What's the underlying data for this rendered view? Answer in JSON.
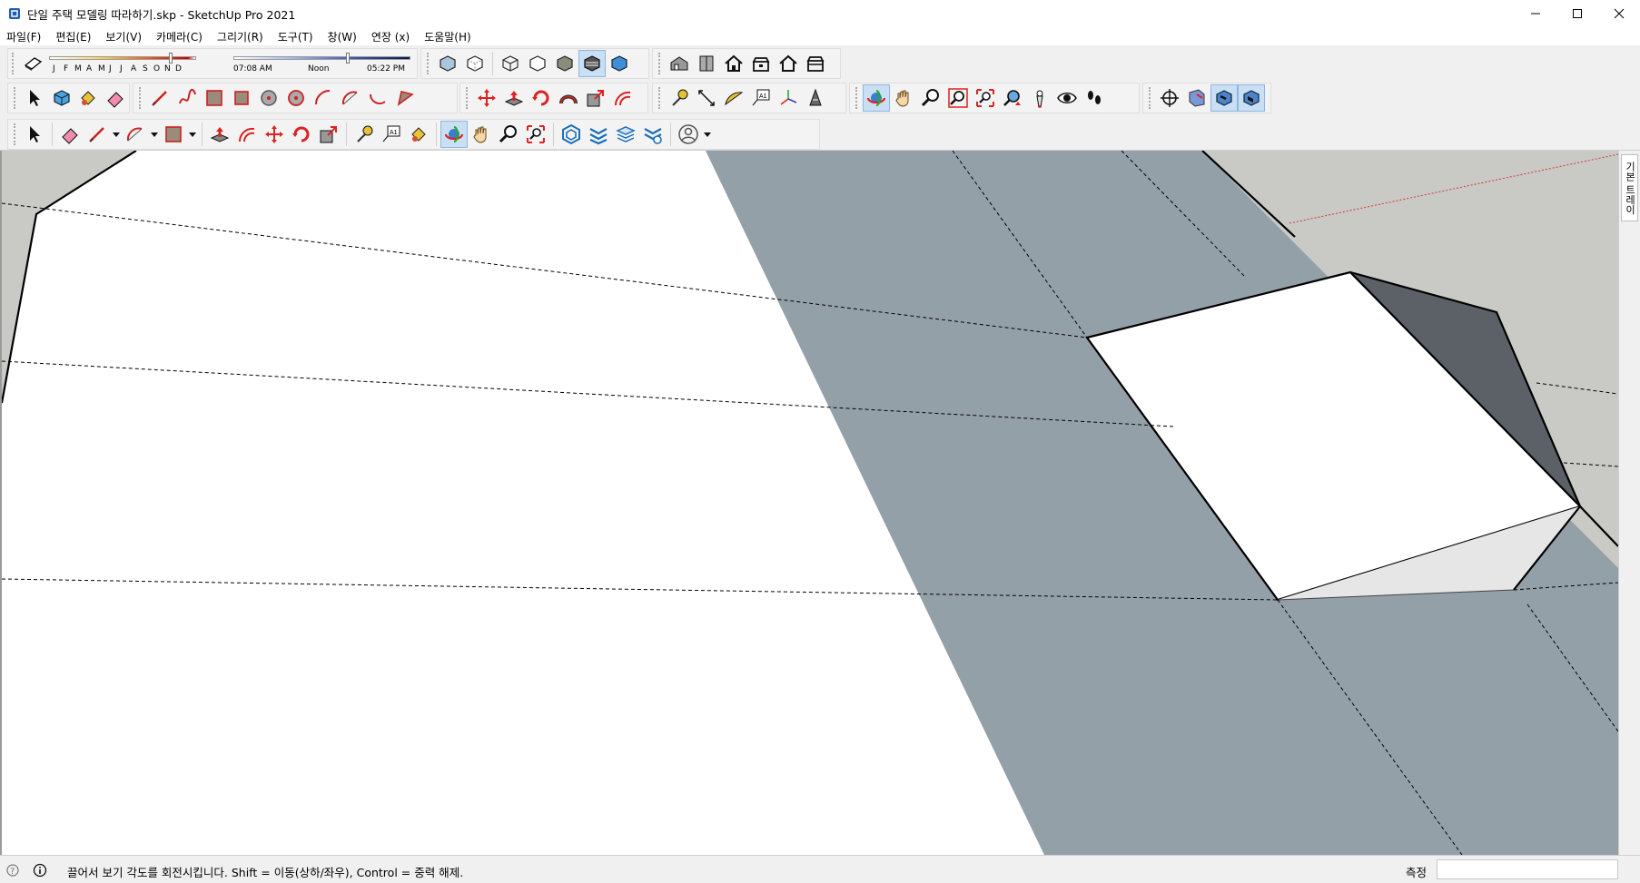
{
  "window": {
    "title": "단일 주택 모델링 따라하기.skp - SketchUp Pro 2021",
    "controls": [
      "minimize",
      "maximize",
      "close"
    ]
  },
  "menu": [
    "파일(F)",
    "편집(E)",
    "보기(V)",
    "카메라(C)",
    "그리기(R)",
    "도구(T)",
    "창(W)",
    "연장 (x)",
    "도움말(H)"
  ],
  "shadow_toolbar": {
    "months": [
      "J",
      "F",
      "M",
      "A",
      "M",
      "J",
      "J",
      "A",
      "S",
      "O",
      "N",
      "D"
    ],
    "time_start": "07:08 AM",
    "time_mid": "Noon",
    "time_end": "05:22 PM"
  },
  "toolbar_icons": {
    "row1": [
      "shadow-toggle-icon",
      "xray-icon",
      "back-edges-icon",
      "wireframe-icon",
      "hidden-line-icon",
      "shaded-icon",
      "shaded-textures-icon",
      "monochrome-icon",
      "iso-view-icon",
      "top-view-icon",
      "front-view-icon",
      "right-view-icon",
      "back-view-icon",
      "left-view-icon"
    ],
    "row2": [
      "select-icon",
      "make-component-icon",
      "paint-bucket-icon",
      "eraser-icon",
      "line-icon",
      "freehand-icon",
      "rectangle-icon",
      "rotated-rectangle-icon",
      "circle-icon",
      "polygon-icon",
      "arc-icon",
      "two-point-arc-icon",
      "three-point-arc-icon",
      "pie-icon",
      "move-icon",
      "push-pull-icon",
      "rotate-icon",
      "follow-me-icon",
      "scale-icon",
      "offset-icon",
      "tape-measure-icon",
      "dimension-icon",
      "protractor-icon",
      "text-icon",
      "axes-icon",
      "3d-text-icon",
      "orbit-icon",
      "pan-icon",
      "zoom-icon",
      "zoom-window-icon",
      "zoom-extents-icon",
      "previous-view-icon",
      "position-camera-icon",
      "look-around-icon",
      "walk-icon",
      "section-plane-icon",
      "display-section-planes-icon",
      "display-section-cuts-icon",
      "display-section-fill-icon"
    ],
    "row3": [
      "select-icon",
      "eraser-icon",
      "line-icon",
      "arc-icon",
      "rectangle-icon",
      "push-pull-icon",
      "offset-icon",
      "move-icon",
      "rotate-icon",
      "scale-icon",
      "tape-measure-icon",
      "text-icon",
      "paint-bucket-icon",
      "orbit-icon",
      "pan-icon",
      "zoom-icon",
      "zoom-extents-icon",
      "3d-warehouse-icon",
      "extension-warehouse-icon",
      "layout-icon",
      "extension-manager-icon",
      "account-icon"
    ]
  },
  "tray": {
    "label": "기본 트레이"
  },
  "status": {
    "message": "끌어서 보기 각도를 회전시킵니다. Shift = 이동(상하/좌우), Control = 중력 해제.",
    "measure_label": "측정",
    "measure_value": ""
  },
  "colors": {
    "roof_shade": "#94a0a8",
    "box_side_dark": "#5c6168",
    "background_gray": "#c9c9c6",
    "active_tool": "#c9dff3"
  }
}
